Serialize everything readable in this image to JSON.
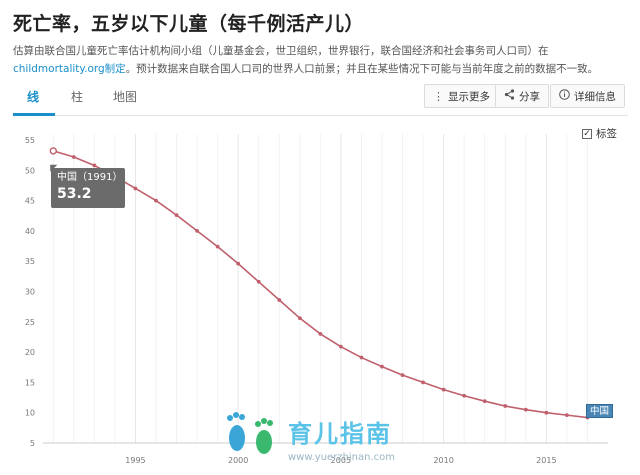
{
  "title": "死亡率，五岁以下儿童（每千例活产儿）",
  "description": {
    "text1": "估算由联合国儿童死亡率估计机构间小组（儿童基金会，世卫组织，世界银行，联合国经济和社会事务司人口司）在",
    "link": "childmortality.org制定",
    "text2": "。预计数据来自联合国人口司的世界人口前景；并且在某些情况下可能与当前年度之前的数据不一致。"
  },
  "tabs": [
    {
      "label": "线",
      "active": true
    },
    {
      "label": "柱",
      "active": false
    },
    {
      "label": "地图",
      "active": false
    }
  ],
  "toolbar": {
    "show_more": "显示更多",
    "share": "分享",
    "details": "详细信息"
  },
  "labels_checkbox": {
    "label": "标签",
    "checked": true
  },
  "tooltip": {
    "label": "中国（1991）",
    "value": "53.2"
  },
  "watermark": {
    "title": "育儿指南",
    "url": "www.yuerzhinan.com"
  },
  "colors": {
    "line": "#c0606c",
    "accent": "#1a8fc9",
    "tooltip_bg": "#6b6b6b",
    "end_label_bg": "#4a86b5"
  },
  "chart_data": {
    "type": "line",
    "title": "",
    "xlabel": "",
    "ylabel": "",
    "x_ticks": [
      1995,
      2000,
      2005,
      2010,
      2015
    ],
    "y_ticks": [
      5,
      10,
      15,
      20,
      25,
      30,
      35,
      40,
      45,
      50,
      55
    ],
    "xlim": [
      1990.5,
      2018
    ],
    "ylim": [
      5,
      55
    ],
    "grid": "vertical",
    "series": [
      {
        "name": "中国",
        "x": [
          1991,
          1992,
          1993,
          1994,
          1995,
          1996,
          1997,
          1998,
          1999,
          2000,
          2001,
          2002,
          2003,
          2004,
          2005,
          2006,
          2007,
          2008,
          2009,
          2010,
          2011,
          2012,
          2013,
          2014,
          2015,
          2016,
          2017
        ],
        "values": [
          53.2,
          52.2,
          50.8,
          49.0,
          47.0,
          45.0,
          42.6,
          40.0,
          37.4,
          34.6,
          31.6,
          28.6,
          25.6,
          23.0,
          20.9,
          19.1,
          17.6,
          16.2,
          15.0,
          13.8,
          12.8,
          11.9,
          11.1,
          10.5,
          10.0,
          9.6,
          9.2
        ]
      }
    ]
  }
}
